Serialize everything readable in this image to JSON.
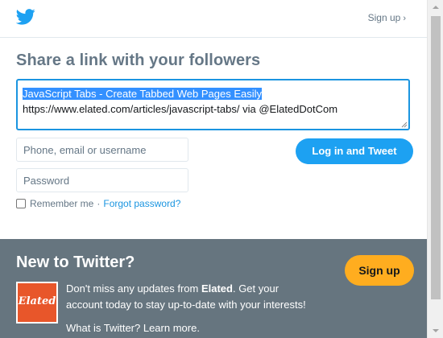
{
  "header": {
    "signup_link": "Sign up",
    "chevron": "›"
  },
  "share": {
    "title": "Share a link with your followers",
    "tweet_selected": "JavaScript Tabs - Create Tabbed Web Pages Easily",
    "tweet_rest": "https://www.elated.com/articles/javascript-tabs/ via @ElatedDotCom"
  },
  "login": {
    "username_placeholder": "Phone, email or username",
    "password_placeholder": "Password",
    "button": "Log in and Tweet",
    "remember": "Remember me",
    "separator": "·",
    "forgot": "Forgot password?"
  },
  "new_to_twitter": {
    "title": "New to Twitter?",
    "signup_button": "Sign up",
    "logo_text": "Elated",
    "promo_before": "Don't miss any updates from ",
    "promo_brand": "Elated",
    "promo_after": ". Get your account today to stay up-to-date with your interests!",
    "whatis": "What is Twitter? Learn more."
  },
  "icons": {
    "brand": "twitter-bird-icon"
  },
  "colors": {
    "twitter_blue": "#1da1f2",
    "signup_orange": "#ffad1f",
    "footer_gray": "#66757f",
    "elated_orange": "#e8562a",
    "selection": "#3390ff"
  }
}
